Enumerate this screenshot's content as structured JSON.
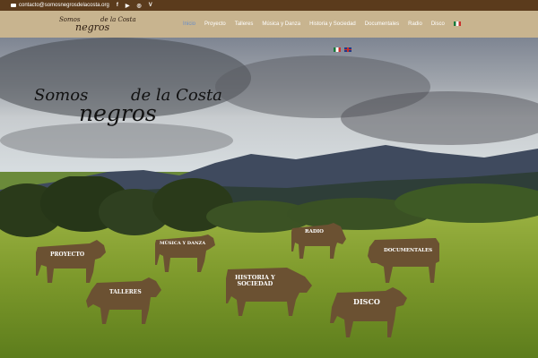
{
  "topbar": {
    "email": "contacto@somosnegrosdelacosta.org",
    "social": [
      {
        "icon": "facebook-icon",
        "glyph": "f"
      },
      {
        "icon": "youtube-icon",
        "glyph": "▶"
      },
      {
        "icon": "instagram-icon",
        "glyph": "◎"
      },
      {
        "icon": "vimeo-icon",
        "glyph": "V"
      }
    ]
  },
  "logo": {
    "line1": "Somos",
    "line2": "negros",
    "line3": "de la Costa"
  },
  "nav": {
    "items": [
      "Inicio",
      "Proyecto",
      "Talleres",
      "Música y Danza",
      "Historia y Sociedad",
      "Documentales",
      "Radio",
      "Disco"
    ],
    "active": "Inicio"
  },
  "hero": {
    "title1": "Somos",
    "title2": "negros",
    "title3": "de la Costa"
  },
  "cows": {
    "proyecto": "PROYECTO",
    "musica": "MÚSICA Y DANZA",
    "radio": "RADIO",
    "documentales": "DOCUMENTALES",
    "talleres": "TALLERES",
    "historia1": "HISTORIA Y",
    "historia2": "SOCIEDAD",
    "disco": "DISCO"
  },
  "colors": {
    "cow": "#6b5132",
    "topbar": "#5b3b1c",
    "header": "#c8b48f",
    "active_nav": "#6a8ec7"
  }
}
